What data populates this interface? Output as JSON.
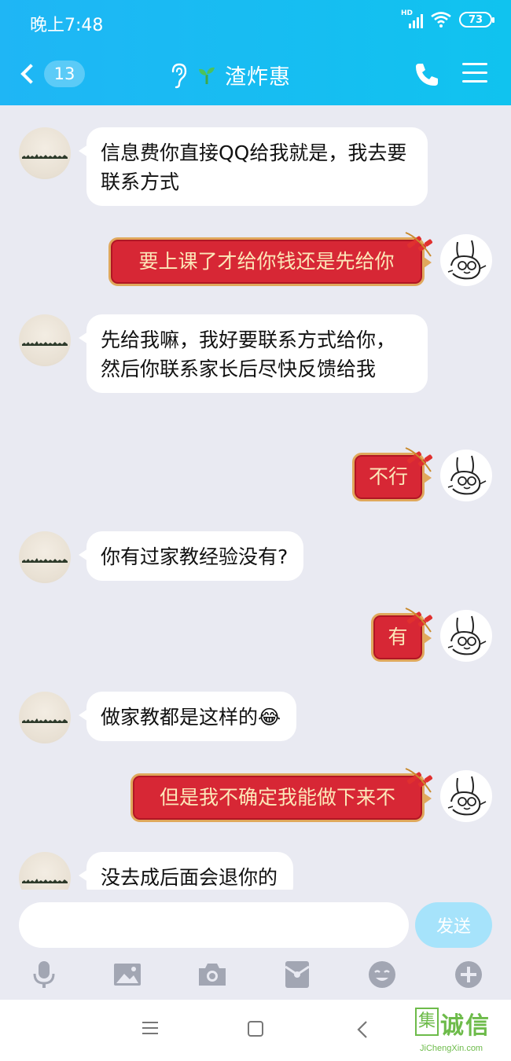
{
  "status_bar": {
    "time": "晚上7:48",
    "network": "HD",
    "battery": "73"
  },
  "nav": {
    "unread_count": "13",
    "chat_title": "渣炸惠"
  },
  "messages": [
    {
      "side": "in",
      "text": "信息费你直接QQ给我就是，我去要联系方式"
    },
    {
      "side": "out",
      "text": "要上课了才给你钱还是先给你"
    },
    {
      "side": "in",
      "text": "先给我嘛，我好要联系方式给你，然后你联系家长后尽快反馈给我"
    },
    {
      "side": "out",
      "text": "不行"
    },
    {
      "side": "in",
      "text": "你有过家教经验没有?"
    },
    {
      "side": "out",
      "text": "有"
    },
    {
      "side": "in",
      "text": "做家教都是这样的😂"
    },
    {
      "side": "out",
      "text": "但是我不确定我能做下来不"
    },
    {
      "side": "in",
      "text": "没去成后面会退你的"
    }
  ],
  "input": {
    "placeholder": "",
    "send_label": "发送"
  },
  "toolbar": [
    "microphone-icon",
    "image-icon",
    "camera-icon",
    "red-packet-icon",
    "emoji-icon",
    "plus-icon"
  ],
  "watermark": {
    "text": "诚信",
    "sub": "JiChengXin.com",
    "logo": "集"
  },
  "colors": {
    "header": "#1fb6f5",
    "out_bubble": "#d72735",
    "out_text": "#fce7b9",
    "send_btn": "#a6e3fb"
  }
}
